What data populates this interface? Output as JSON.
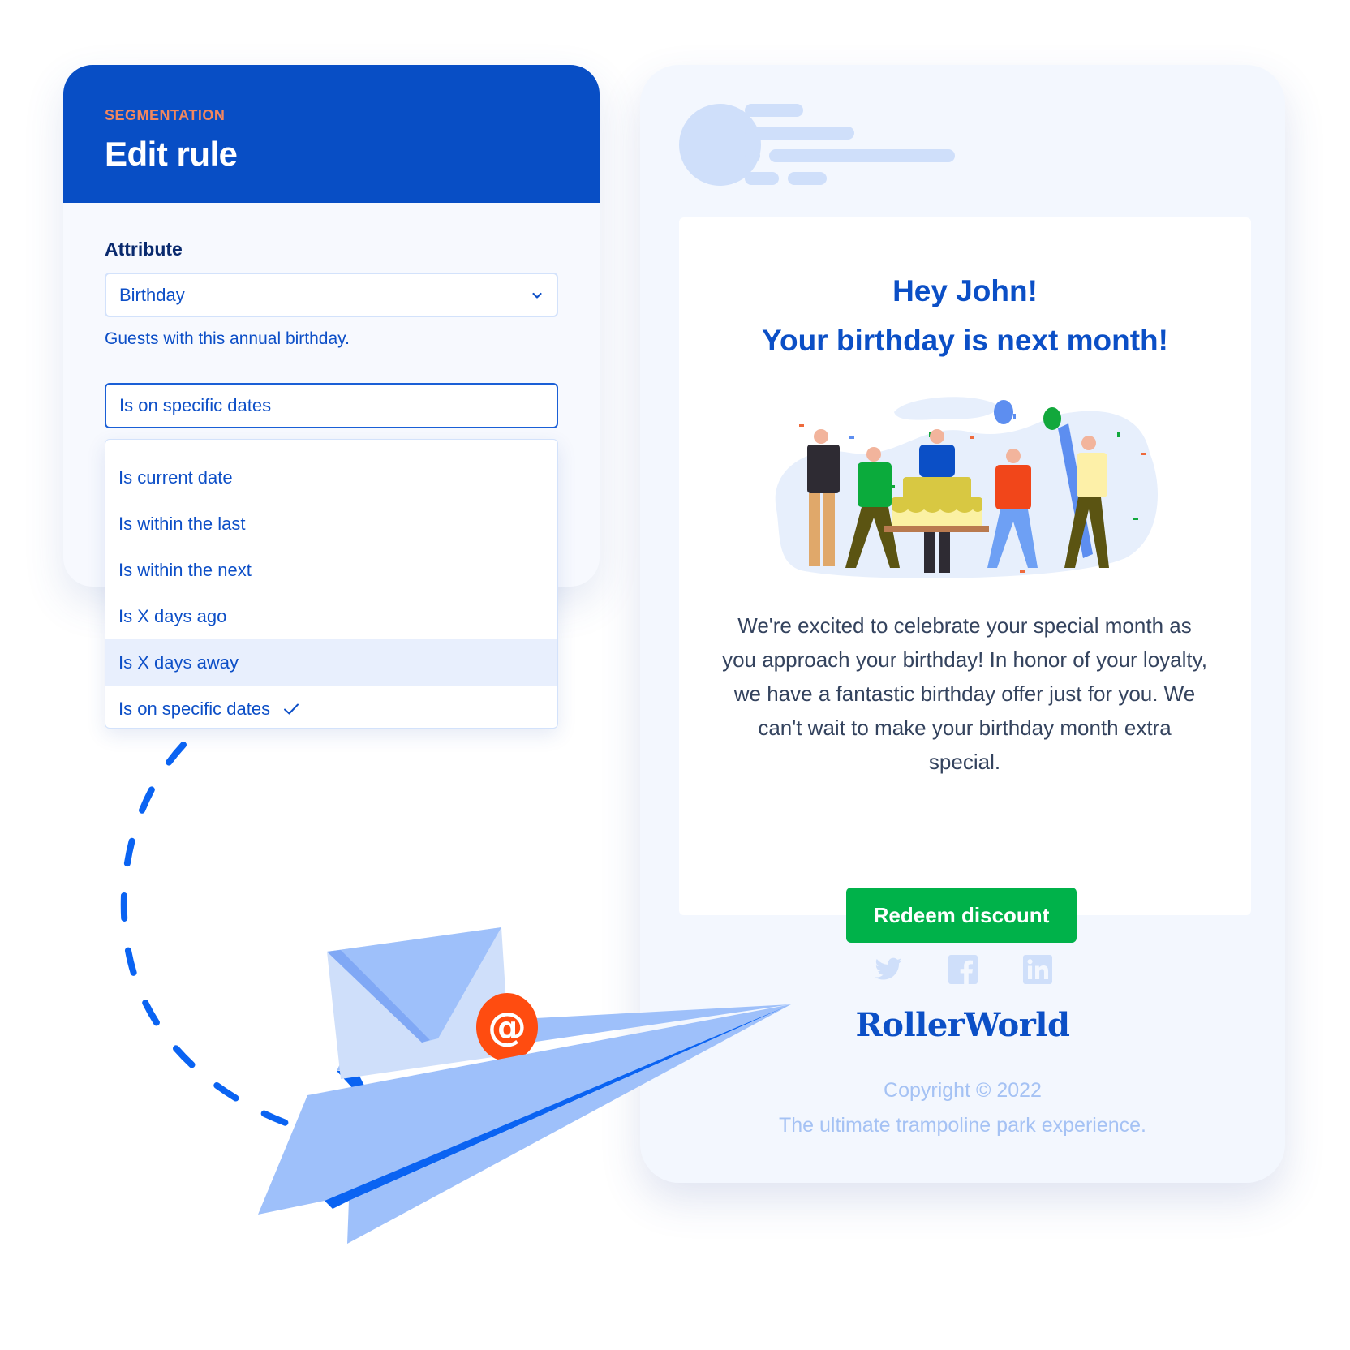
{
  "rule_editor": {
    "eyebrow": "SEGMENTATION",
    "title": "Edit rule",
    "attribute_label": "Attribute",
    "attribute_value": "Birthday",
    "attribute_helper": "Guests with this annual birthday.",
    "operator_value": "Is on specific dates",
    "operator_options": [
      {
        "label": "Is current date",
        "selected": false,
        "hovered": false
      },
      {
        "label": "Is within the last",
        "selected": false,
        "hovered": false
      },
      {
        "label": "Is within the next",
        "selected": false,
        "hovered": false
      },
      {
        "label": "Is X days ago",
        "selected": false,
        "hovered": false
      },
      {
        "label": "Is X days away",
        "selected": false,
        "hovered": true
      },
      {
        "label": "Is on specific dates",
        "selected": true,
        "hovered": false
      }
    ]
  },
  "email_preview": {
    "greeting": "Hey John!",
    "headline": "Your birthday is next month!",
    "illustration": "birthday-party-illustration",
    "message": "We're excited to celebrate your special month as you approach your birthday! In honor of your loyalty, we have a fantastic birthday offer just for you.  We can't wait to make your birthday month extra special.",
    "cta_label": "Redeem discount",
    "social_icons": [
      "twitter-icon",
      "facebook-icon",
      "linkedin-icon"
    ],
    "brand_name": "RollerWorld",
    "copyright": "Copyright © 2022",
    "tagline": "The ultimate trampoline park experience."
  },
  "decoration": {
    "icon": "paper-plane-envelope-icon",
    "at_symbol": "@"
  },
  "colors": {
    "primary": "#084ec5",
    "accent_orange": "#f2875e",
    "cta_green": "#00b24a",
    "placeholder_blue": "#cfdffa",
    "at_badge": "#ff4c10"
  }
}
